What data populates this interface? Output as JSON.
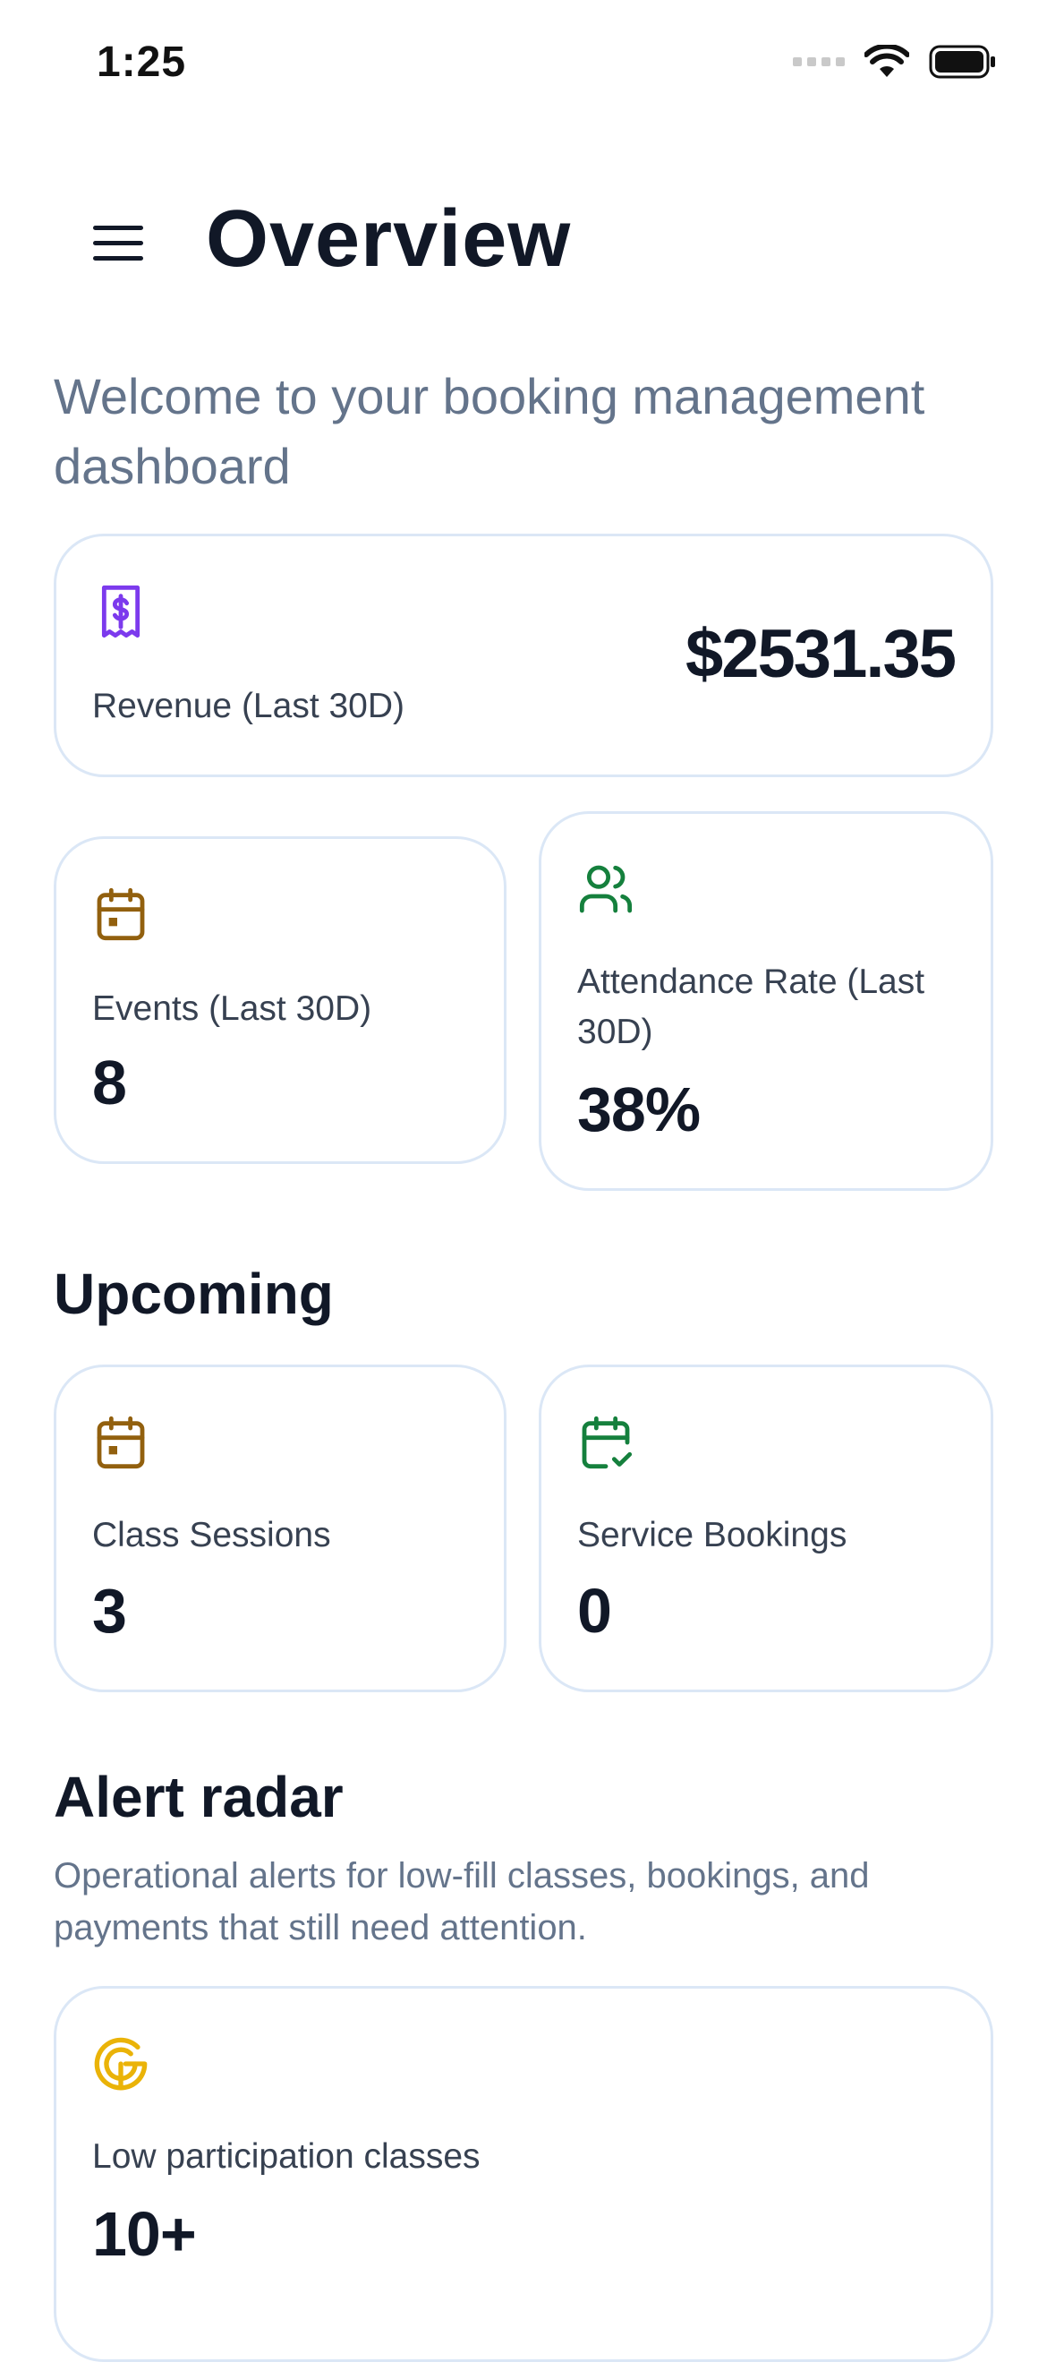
{
  "status_bar": {
    "time": "1:25"
  },
  "header": {
    "title": "Overview",
    "menu_icon": "hamburger-menu-icon"
  },
  "subtitle": "Welcome to your booking management dashboard",
  "stats": {
    "revenue": {
      "label": "Revenue (Last 30D)",
      "value": "$2531.35",
      "icon": "receipt-dollar-icon",
      "color": "#7c3aed"
    },
    "events": {
      "label": "Events (Last 30D)",
      "value": "8",
      "icon": "calendar-icon",
      "color": "#92600e"
    },
    "attendance": {
      "label": "Attendance Rate (Last 30D)",
      "value": "38%",
      "icon": "users-icon",
      "color": "#15803d"
    }
  },
  "upcoming": {
    "title": "Upcoming",
    "class_sessions": {
      "label": "Class Sessions",
      "value": "3",
      "icon": "calendar-icon",
      "color": "#92600e"
    },
    "service_bookings": {
      "label": "Service Bookings",
      "value": "0",
      "icon": "calendar-check-icon",
      "color": "#15803d"
    }
  },
  "alert_radar": {
    "title": "Alert radar",
    "description": "Operational alerts for low-fill classes, bookings, and payments that still need attention.",
    "low_participation": {
      "label": "Low participation classes",
      "value": "10+",
      "icon": "radar-icon",
      "color": "#eab308"
    }
  }
}
